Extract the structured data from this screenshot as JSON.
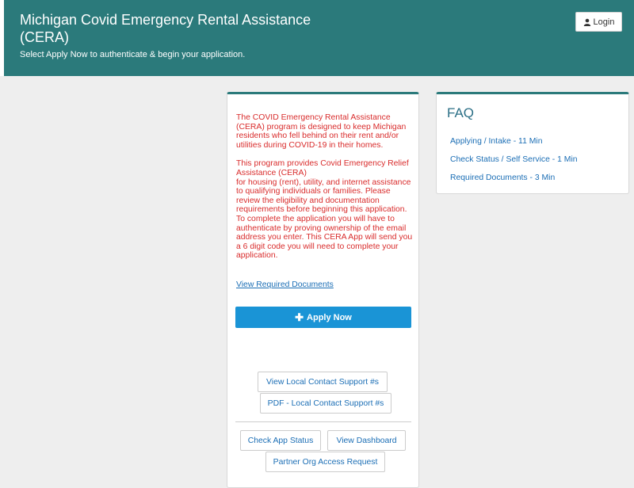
{
  "header": {
    "title": "Michigan Covid Emergency Rental Assistance (CERA)",
    "subtitle": "Select Apply Now to authenticate & begin your application.",
    "login_label": "Login"
  },
  "main": {
    "intro_paragraph_1": "The COVID Emergency Rental Assistance (CERA) program is designed to keep Michigan residents who fell behind on their rent and/or utilities during COVID-19 in their homes.",
    "intro_paragraph_2_line_1": "This program provides Covid Emergency Relief Assistance (CERA)",
    "intro_paragraph_2_line_2": "for housing (rent), utility, and internet assistance to qualifying individuals or families. Please review the eligibility and documentation requirements before beginning this application. To complete the application you will have to authenticate by proving ownership of the email address you enter. This CERA App will send you a 6 digit code you will need to complete your application.",
    "view_required_docs": "View Required Documents",
    "apply_now": "Apply Now",
    "local_contact": "View Local Contact Support #s",
    "pdf_local_contact": "PDF - Local Contact Support #s",
    "check_status": "Check App Status",
    "view_dashboard": "View Dashboard",
    "partner_access": "Partner Org Access Request"
  },
  "faq": {
    "title": "FAQ",
    "items": [
      "Applying / Intake - 11 Min",
      "Check Status / Self Service - 1 Min",
      "Required Documents - 3 Min"
    ]
  },
  "colors": {
    "header_bg": "#2b7a7b",
    "intro_text": "#d92c2c",
    "primary_button": "#1a94d6",
    "link": "#1b6eb5"
  },
  "icons": {
    "login": "user-icon",
    "apply": "plus-icon"
  }
}
